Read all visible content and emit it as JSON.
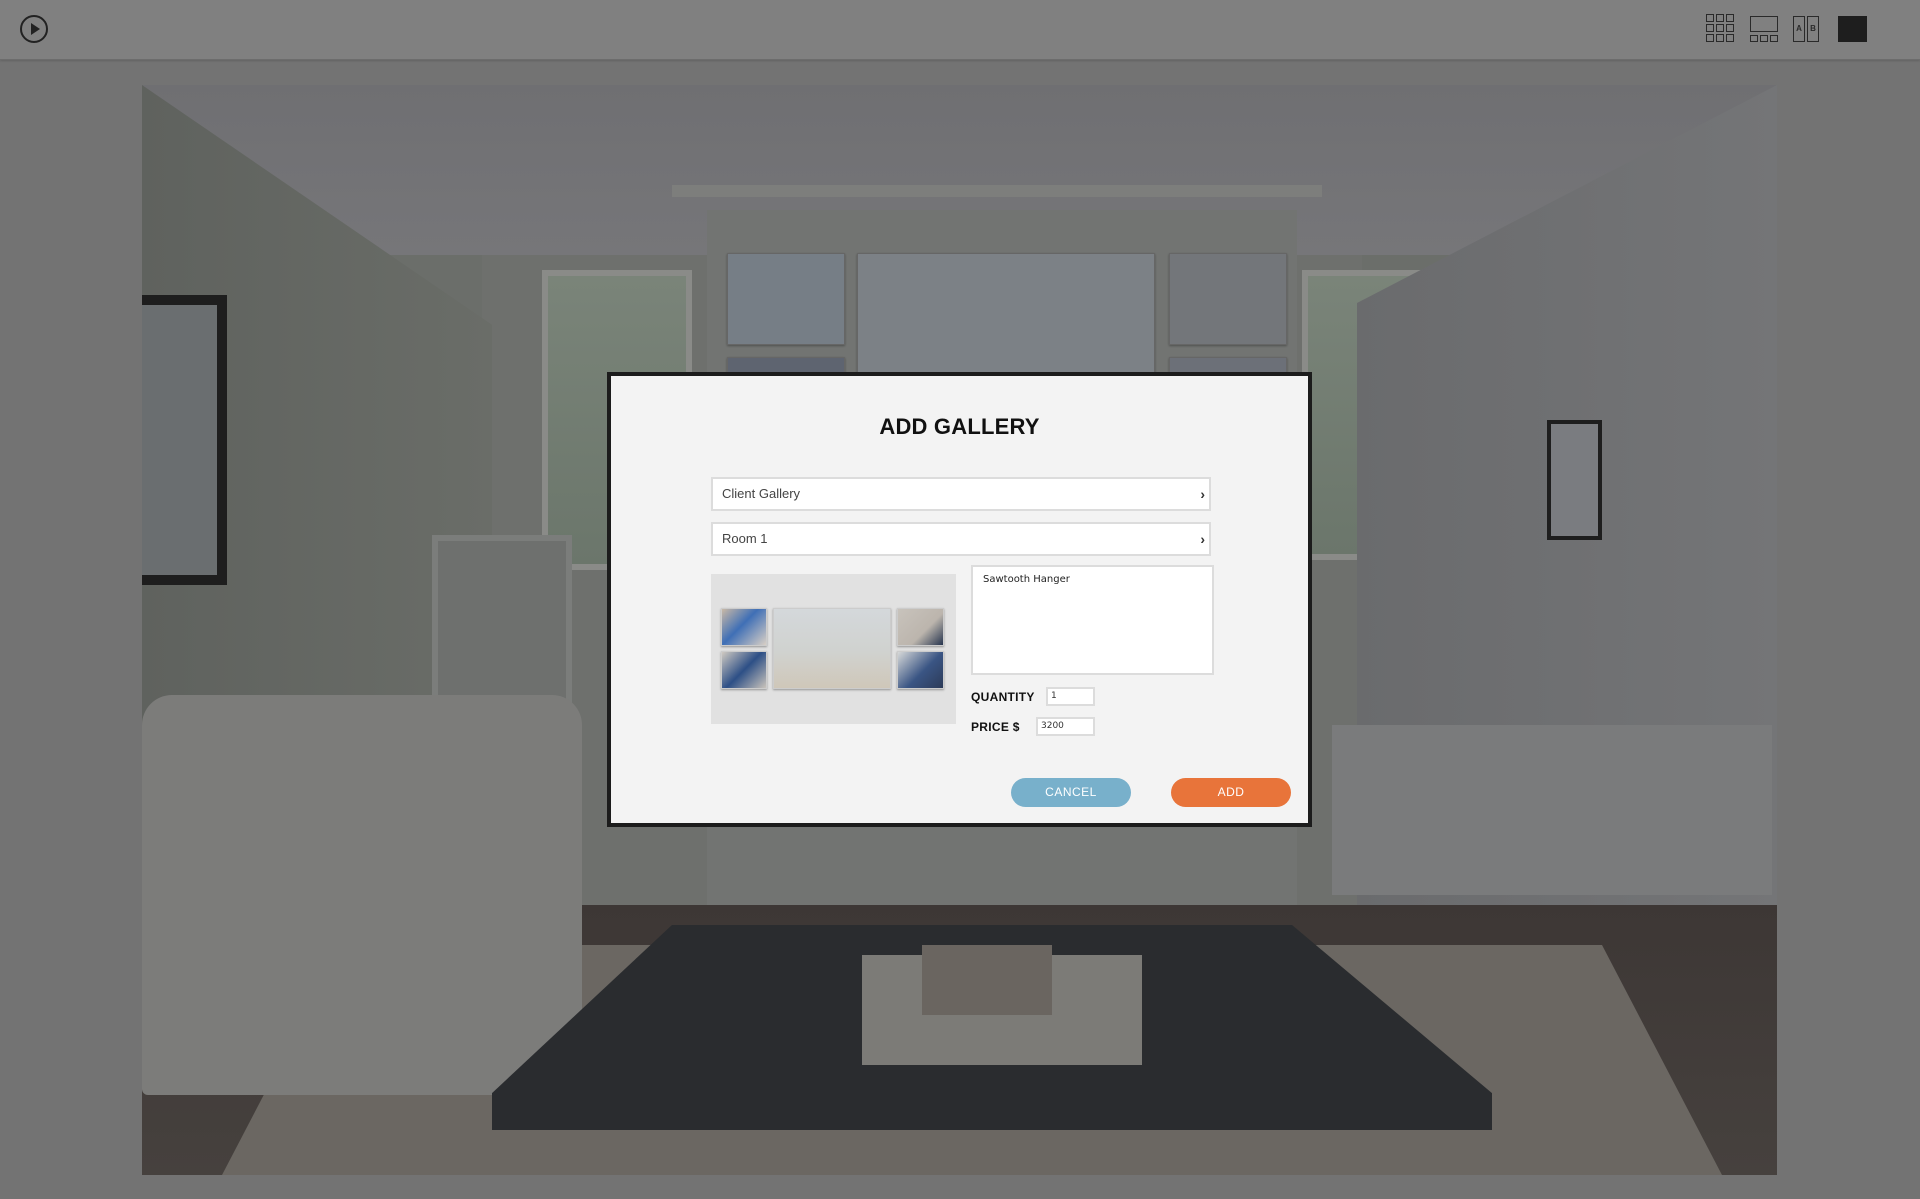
{
  "toolbar": {
    "play_icon": "play-circle-icon",
    "view_modes": [
      {
        "name": "grid-view",
        "icon": "grid-3x3-icon"
      },
      {
        "name": "filmstrip-view",
        "icon": "filmstrip-icon"
      },
      {
        "name": "compare-view",
        "icon": "ab-compare-icon",
        "labels": [
          "A",
          "B"
        ]
      },
      {
        "name": "single-view",
        "icon": "single-square-icon"
      }
    ]
  },
  "modal": {
    "title": "ADD GALLERY",
    "gallery_select": {
      "value": "Client Gallery",
      "icon": "chevron-right-icon"
    },
    "room_select": {
      "value": "Room 1",
      "icon": "chevron-right-icon"
    },
    "description": "Sawtooth Hanger",
    "quantity": {
      "label": "QUANTITY",
      "value": "1"
    },
    "price": {
      "label": "PRICE $",
      "value": "3200"
    },
    "cancel_label": "CANCEL",
    "add_label": "ADD",
    "colors": {
      "cancel": "#78b0cb",
      "add": "#e8743a"
    }
  },
  "chevron": "›"
}
